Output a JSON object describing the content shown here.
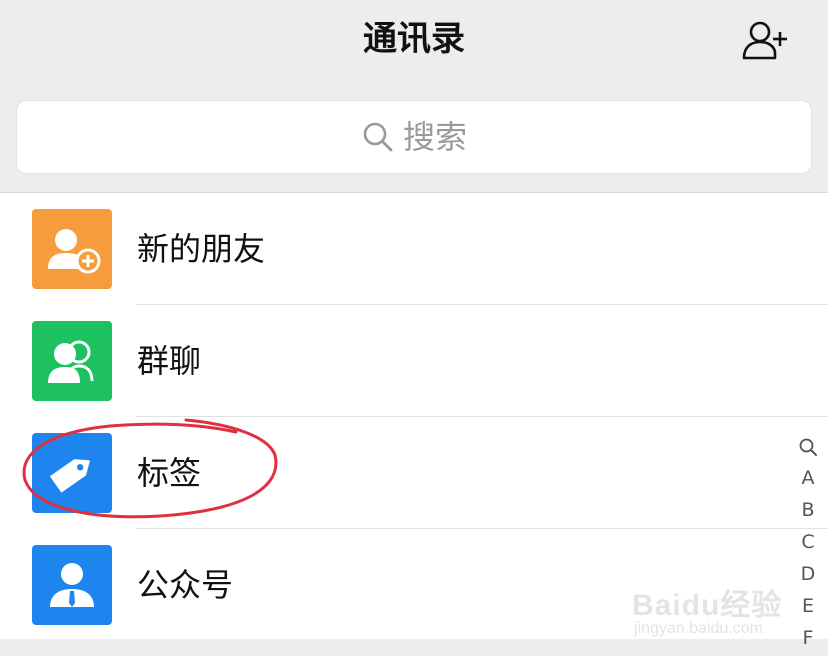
{
  "header": {
    "title": "通讯录",
    "add_icon": "add-contact-icon"
  },
  "search": {
    "placeholder": "搜索",
    "icon": "search-icon"
  },
  "list": {
    "items": [
      {
        "label": "新的朋友",
        "icon": "new-friend-icon",
        "color": "#f79c3c"
      },
      {
        "label": "群聊",
        "icon": "group-chat-icon",
        "color": "#1ec15f"
      },
      {
        "label": "标签",
        "icon": "tag-icon",
        "color": "#1f85ee"
      },
      {
        "label": "公众号",
        "icon": "official-account-icon",
        "color": "#1f85ee"
      }
    ]
  },
  "index_bar": {
    "search_icon": "search-icon",
    "letters": [
      "A",
      "B",
      "C",
      "D",
      "E",
      "F"
    ]
  },
  "annotation": {
    "color": "#e0303f",
    "highlighted_item": "标签"
  },
  "watermark": {
    "logo": "Baidu经验",
    "url": "jingyan.baidu.com"
  }
}
